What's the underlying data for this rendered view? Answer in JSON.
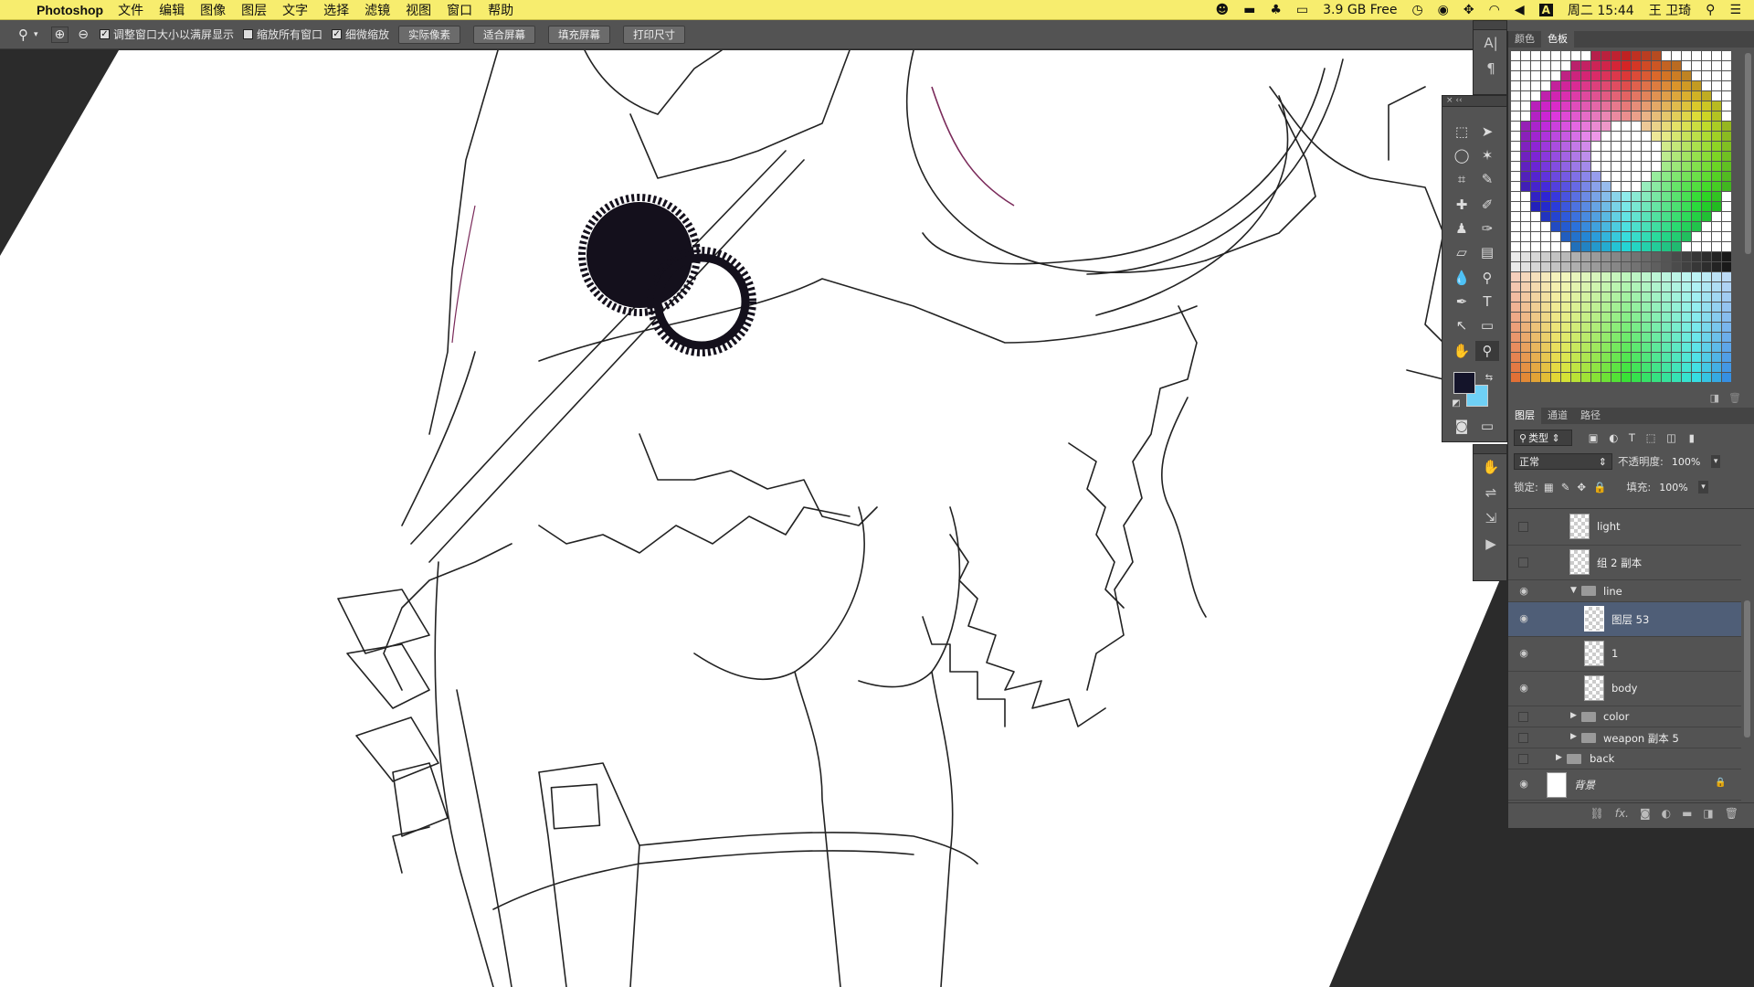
{
  "menubar": {
    "app_name": "Photoshop",
    "menus": [
      "文件",
      "编辑",
      "图像",
      "图层",
      "文字",
      "选择",
      "滤镜",
      "视图",
      "窗口",
      "帮助"
    ],
    "memory": "3.9 GB Free",
    "clock": "周二 15:44",
    "user": "王 卫琦",
    "input_method": "A"
  },
  "options_bar": {
    "checkboxes": [
      {
        "label": "调整窗口大小以满屏显示",
        "checked": true
      },
      {
        "label": "缩放所有窗口",
        "checked": false
      },
      {
        "label": "细微缩放",
        "checked": true
      }
    ],
    "buttons": [
      "实际像素",
      "适合屏幕",
      "填充屏幕",
      "打印尺寸"
    ]
  },
  "swatches_panel": {
    "tabs": [
      "颜色",
      "色板"
    ],
    "active_tab": "色板"
  },
  "layers_panel": {
    "tabs": [
      "图层",
      "通道",
      "路径"
    ],
    "active_tab": "图层",
    "filter_label": "类型",
    "blend_mode": "正常",
    "opacity_label": "不透明度:",
    "opacity_value": "100%",
    "lock_label": "锁定:",
    "fill_label": "填充:",
    "fill_value": "100%",
    "layers": [
      {
        "name": "light",
        "type": "layer",
        "visible": false,
        "indent": 0,
        "selected": false
      },
      {
        "name": "组 2 副本",
        "type": "layer",
        "visible": false,
        "indent": 0,
        "selected": false
      },
      {
        "name": "line",
        "type": "group-open",
        "visible": true,
        "indent": 0,
        "selected": false
      },
      {
        "name": "图层 53",
        "type": "layer",
        "visible": true,
        "indent": 1,
        "selected": true
      },
      {
        "name": "1",
        "type": "layer",
        "visible": true,
        "indent": 1,
        "selected": false
      },
      {
        "name": "body",
        "type": "layer",
        "visible": true,
        "indent": 1,
        "selected": false
      },
      {
        "name": "color",
        "type": "group",
        "visible": false,
        "indent": 0,
        "selected": false
      },
      {
        "name": "weapon 副本 5",
        "type": "group",
        "visible": false,
        "indent": 0,
        "selected": false
      },
      {
        "name": "back",
        "type": "group",
        "visible": false,
        "indent": -1,
        "selected": false
      },
      {
        "name": "背景",
        "type": "background",
        "visible": true,
        "indent": -1,
        "selected": false
      }
    ]
  },
  "colors": {
    "menubar": "#f7ed6e",
    "foreground": "#14142a",
    "background": "#6fd0f5",
    "selected_layer": "#4f5e77"
  }
}
